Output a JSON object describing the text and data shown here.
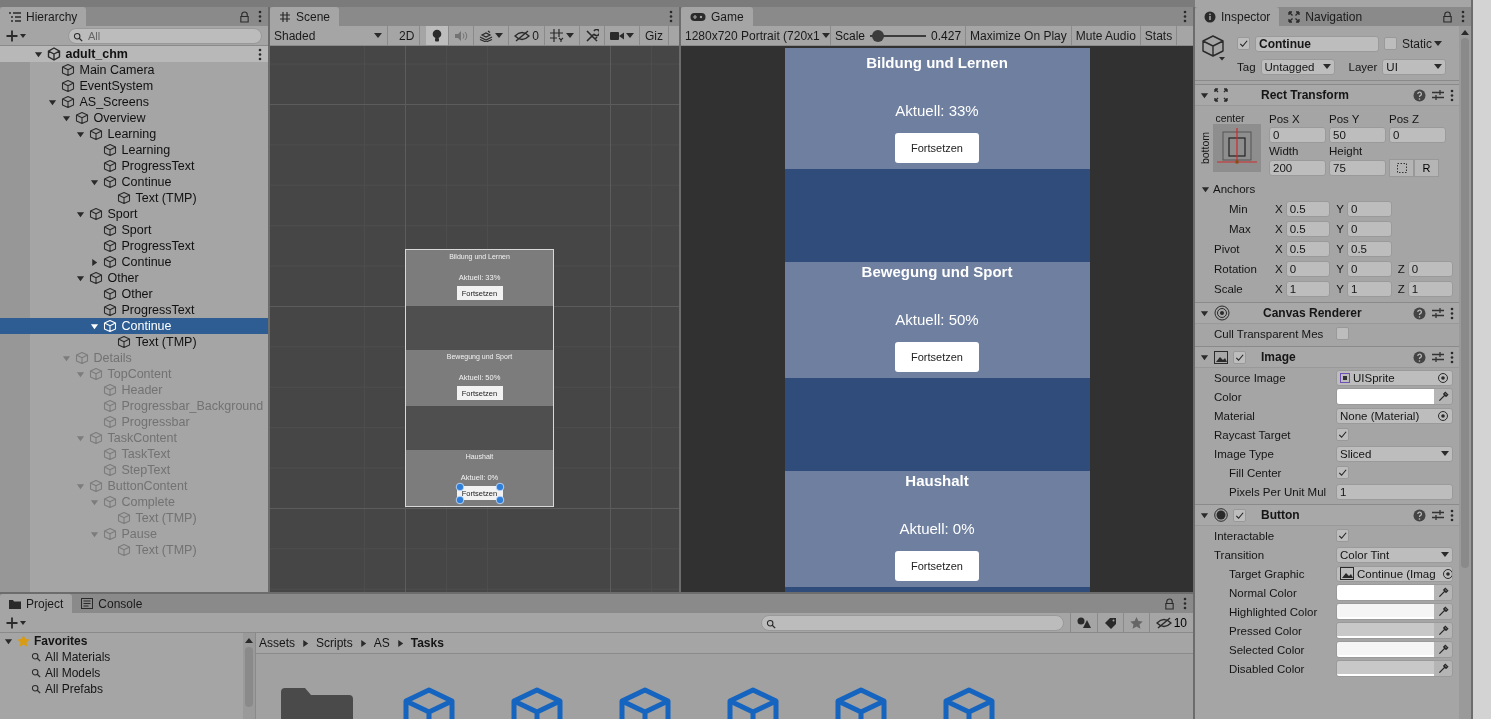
{
  "hierarchy": {
    "tab": {
      "label": "Hierarchy",
      "selected": true
    },
    "search_placeholder": "All",
    "scene": {
      "name": "adult_chm",
      "expanded": true,
      "children": [
        {
          "name": "Main Camera",
          "selected": false,
          "active": true
        },
        {
          "name": "EventSystem",
          "selected": false,
          "active": true
        },
        {
          "name": "AS_Screens",
          "expanded": true,
          "selected": false,
          "active": true,
          "children": [
            {
              "name": "Overview",
              "expanded": true,
              "selected": false,
              "active": true,
              "children": [
                {
                  "name": "Learning",
                  "expanded": true,
                  "selected": false,
                  "active": true,
                  "children": [
                    {
                      "name": "Learning",
                      "selected": false,
                      "active": true
                    },
                    {
                      "name": "ProgressText",
                      "selected": false,
                      "active": true
                    },
                    {
                      "name": "Continue",
                      "expanded": true,
                      "selected": false,
                      "active": true,
                      "children": [
                        {
                          "name": "Text (TMP)",
                          "selected": false,
                          "active": true
                        }
                      ]
                    }
                  ]
                },
                {
                  "name": "Sport",
                  "expanded": true,
                  "selected": false,
                  "active": true,
                  "children": [
                    {
                      "name": "Sport",
                      "selected": false,
                      "active": true
                    },
                    {
                      "name": "ProgressText",
                      "selected": false,
                      "active": true
                    },
                    {
                      "name": "Continue",
                      "expanded": false,
                      "selected": false,
                      "active": true
                    }
                  ]
                },
                {
                  "name": "Other",
                  "expanded": true,
                  "selected": false,
                  "active": true,
                  "children": [
                    {
                      "name": "Other",
                      "selected": false,
                      "active": true
                    },
                    {
                      "name": "ProgressText",
                      "selected": false,
                      "active": true
                    },
                    {
                      "name": "Continue",
                      "expanded": true,
                      "selected": true,
                      "active": true,
                      "children": [
                        {
                          "name": "Text (TMP)",
                          "selected": false,
                          "active": true
                        }
                      ]
                    }
                  ]
                }
              ]
            },
            {
              "name": "Details",
              "expanded": true,
              "selected": false,
              "active": false,
              "children": [
                {
                  "name": "TopContent",
                  "expanded": true,
                  "selected": false,
                  "active": false,
                  "children": [
                    {
                      "name": "Header",
                      "selected": false,
                      "active": false
                    },
                    {
                      "name": "Progressbar_Background",
                      "selected": false,
                      "active": false
                    },
                    {
                      "name": "Progressbar",
                      "selected": false,
                      "active": false
                    }
                  ]
                },
                {
                  "name": "TaskContent",
                  "expanded": true,
                  "selected": false,
                  "active": false,
                  "children": [
                    {
                      "name": "TaskText",
                      "selected": false,
                      "active": false
                    },
                    {
                      "name": "StepText",
                      "selected": false,
                      "active": false
                    }
                  ]
                },
                {
                  "name": "ButtonContent",
                  "expanded": true,
                  "selected": false,
                  "active": false,
                  "children": [
                    {
                      "name": "Complete",
                      "expanded": true,
                      "selected": false,
                      "active": false,
                      "children": [
                        {
                          "name": "Text (TMP)",
                          "selected": false,
                          "active": false
                        }
                      ]
                    },
                    {
                      "name": "Pause",
                      "expanded": true,
                      "selected": false,
                      "active": false,
                      "children": [
                        {
                          "name": "Text (TMP)",
                          "selected": false,
                          "active": false
                        }
                      ]
                    }
                  ]
                }
              ]
            }
          ]
        }
      ]
    }
  },
  "scene_view": {
    "tab": {
      "label": "Scene",
      "selected": true
    },
    "shading": "Shaded",
    "toggle_2d": {
      "label": "2D",
      "on": false
    },
    "lighting_on": true,
    "audio_on": false,
    "hidden_count": "0",
    "gizmos": "Giz",
    "canvas_panels": [
      {
        "title": "Bildung und Lernen",
        "progress": "Aktuell: 33%",
        "button": "Fortsetzen",
        "selected": false
      },
      {
        "title": "Bewegung und Sport",
        "progress": "Aktuell: 50%",
        "button": "Fortsetzen",
        "selected": false
      },
      {
        "title": "Haushalt",
        "progress": "Aktuell: 0%",
        "button": "Fortsetzen",
        "selected": true
      }
    ]
  },
  "game_view": {
    "tab": {
      "label": "Game",
      "selected": true
    },
    "resolution": "1280x720 Portrait (720x1",
    "scale_label": "Scale",
    "scale": {
      "level": 0.05
    },
    "scale_value": "0.427",
    "buttons": [
      "Maximize On Play",
      "Mute Audio",
      "Stats"
    ],
    "panels": [
      {
        "title": "Bildung und Lernen",
        "progress": "Aktuell: 33%",
        "button": "Fortsetzen"
      },
      {
        "title": "Bewegung und Sport",
        "progress": "Aktuell: 50%",
        "button": "Fortsetzen"
      },
      {
        "title": "Haushalt",
        "progress": "Aktuell: 0%",
        "button": "Fortsetzen"
      }
    ]
  },
  "inspector": {
    "tabs": [
      {
        "label": "Inspector",
        "selected": true
      },
      {
        "label": "Navigation",
        "selected": false
      }
    ],
    "object": {
      "active": true,
      "name": "Continue",
      "static": false,
      "static_label": "Static",
      "tag_label": "Tag",
      "tag": "Untagged",
      "layer_label": "Layer",
      "layer": "UI"
    },
    "components": [
      {
        "kind": "rect_transform",
        "title": "Rect Transform",
        "expanded": true,
        "anchor_horizontal": "center",
        "anchor_vertical": "bottom",
        "fields": [
          {
            "label": "Pos X",
            "value": "0"
          },
          {
            "label": "Pos Y",
            "value": "50"
          },
          {
            "label": "Pos Z",
            "value": "0"
          },
          {
            "label": "Width",
            "value": "200"
          },
          {
            "label": "Height",
            "value": "75"
          }
        ],
        "raw_button": "R",
        "rows": [
          {
            "kind": "foldout",
            "label": "Anchors",
            "expanded": true,
            "children": [
              {
                "kind": "vector",
                "label": "Min",
                "fields": [
                  {
                    "axis": "X",
                    "value": "0.5"
                  },
                  {
                    "axis": "Y",
                    "value": "0"
                  }
                ]
              },
              {
                "kind": "vector",
                "label": "Max",
                "fields": [
                  {
                    "axis": "X",
                    "value": "0.5"
                  },
                  {
                    "axis": "Y",
                    "value": "0"
                  }
                ]
              }
            ]
          },
          {
            "kind": "vector",
            "label": "Pivot",
            "fields": [
              {
                "axis": "X",
                "value": "0.5"
              },
              {
                "axis": "Y",
                "value": "0.5"
              }
            ]
          },
          {
            "kind": "vector",
            "label": "Rotation",
            "fields": [
              {
                "axis": "X",
                "value": "0"
              },
              {
                "axis": "Y",
                "value": "0"
              },
              {
                "axis": "Z",
                "value": "0"
              }
            ]
          },
          {
            "kind": "vector",
            "label": "Scale",
            "fields": [
              {
                "axis": "X",
                "value": "1"
              },
              {
                "axis": "Y",
                "value": "1"
              },
              {
                "axis": "Z",
                "value": "1"
              }
            ]
          }
        ]
      },
      {
        "kind": "canvas_renderer",
        "title": "Canvas Renderer",
        "expanded": true,
        "rows": [
          {
            "kind": "check",
            "label": "Cull Transparent Mes",
            "checked": false
          }
        ]
      },
      {
        "kind": "image",
        "title": "Image",
        "expanded": true,
        "enabled": true,
        "rows": [
          {
            "kind": "sprite_ref",
            "label": "Source Image",
            "value": "UISprite"
          },
          {
            "kind": "color",
            "label": "Color",
            "color": "#ffffff"
          },
          {
            "kind": "object",
            "label": "Material",
            "value": "None (Material)"
          },
          {
            "kind": "check",
            "label": "Raycast Target",
            "checked": true
          },
          {
            "kind": "dropdown",
            "label": "Image Type",
            "value": "Sliced",
            "children": [
              {
                "kind": "check",
                "label": "Fill Center",
                "checked": true
              },
              {
                "kind": "number",
                "label": "Pixels Per Unit Mul",
                "value": "1"
              }
            ]
          }
        ]
      },
      {
        "kind": "button",
        "title": "Button",
        "expanded": true,
        "enabled": true,
        "rows": [
          {
            "kind": "check",
            "label": "Interactable",
            "checked": true
          },
          {
            "kind": "dropdown",
            "label": "Transition",
            "value": "Color Tint",
            "children": [
              {
                "kind": "image_ref",
                "label": "Target Graphic",
                "value": "Continue (Imag"
              },
              {
                "kind": "color",
                "label": "Normal Color",
                "color": "#ffffff"
              },
              {
                "kind": "color",
                "label": "Highlighted Color",
                "color": "#f5f5f5"
              },
              {
                "kind": "color",
                "label": "Pressed Color",
                "color": "#c8c8c8"
              },
              {
                "kind": "color",
                "label": "Selected Color",
                "color": "#f5f5f5"
              },
              {
                "kind": "color",
                "label": "Disabled Color",
                "color": "#c8c8c8"
              }
            ]
          }
        ]
      }
    ]
  },
  "project": {
    "tabs": [
      {
        "label": "Project",
        "selected": true
      },
      {
        "label": "Console",
        "selected": false
      }
    ],
    "hidden_count": "10",
    "favorites": {
      "label": "Favorites",
      "expanded": true,
      "children": [
        {
          "label": "All Materials"
        },
        {
          "label": "All Models"
        },
        {
          "label": "All Prefabs"
        }
      ]
    },
    "breadcrumb": [
      "Assets",
      "Scripts",
      "AS",
      "Tasks"
    ],
    "assets": [
      {
        "kind": "folder"
      },
      {
        "kind": "prefab"
      },
      {
        "kind": "prefab"
      },
      {
        "kind": "prefab"
      },
      {
        "kind": "prefab"
      },
      {
        "kind": "prefab"
      },
      {
        "kind": "prefab"
      }
    ]
  }
}
